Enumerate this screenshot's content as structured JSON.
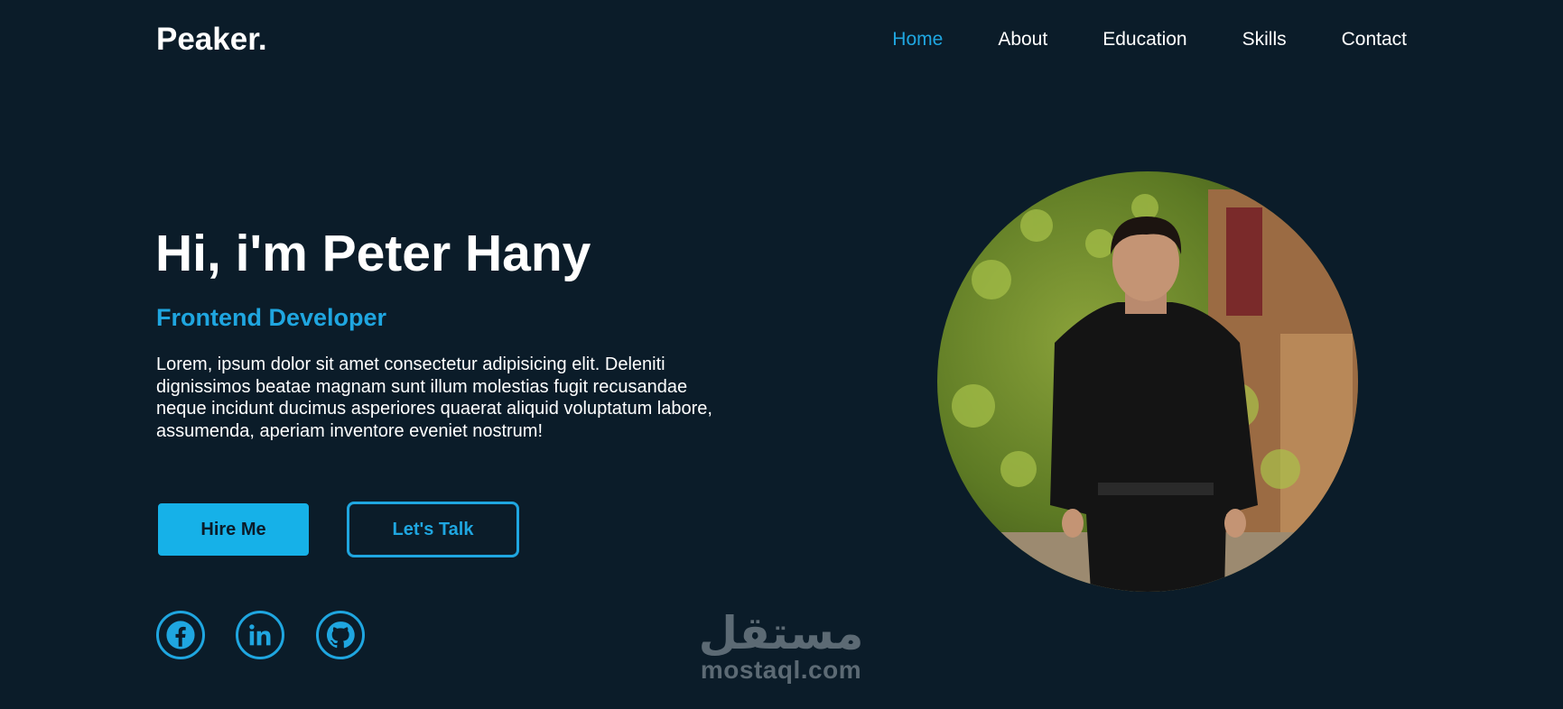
{
  "brand": {
    "logo": "Peaker."
  },
  "nav": {
    "items": [
      {
        "label": "Home",
        "active": true
      },
      {
        "label": "About",
        "active": false
      },
      {
        "label": "Education",
        "active": false
      },
      {
        "label": "Skills",
        "active": false
      },
      {
        "label": "Contact",
        "active": false
      }
    ]
  },
  "hero": {
    "title": "Hi, i'm Peter Hany",
    "role": "Frontend Developer",
    "description": "Lorem, ipsum dolor sit amet consectetur adipisicing elit. Deleniti dignissimos beatae magnam sunt illum molestias fugit recusandae neque incidunt ducimus asperiores quaerat aliquid voluptatum labore, assumenda, aperiam inventore eveniet nostrum!",
    "primary_button": "Hire Me",
    "secondary_button": "Let's Talk"
  },
  "social": {
    "icons": [
      "facebook-icon",
      "linkedin-icon",
      "github-icon"
    ]
  },
  "watermark": {
    "arabic": "مستقل",
    "latin": "mostaql.com"
  },
  "colors": {
    "background": "#0b1c29",
    "accent": "#1fa6e0",
    "button_fill": "#16b1e8",
    "text": "#ffffff"
  }
}
